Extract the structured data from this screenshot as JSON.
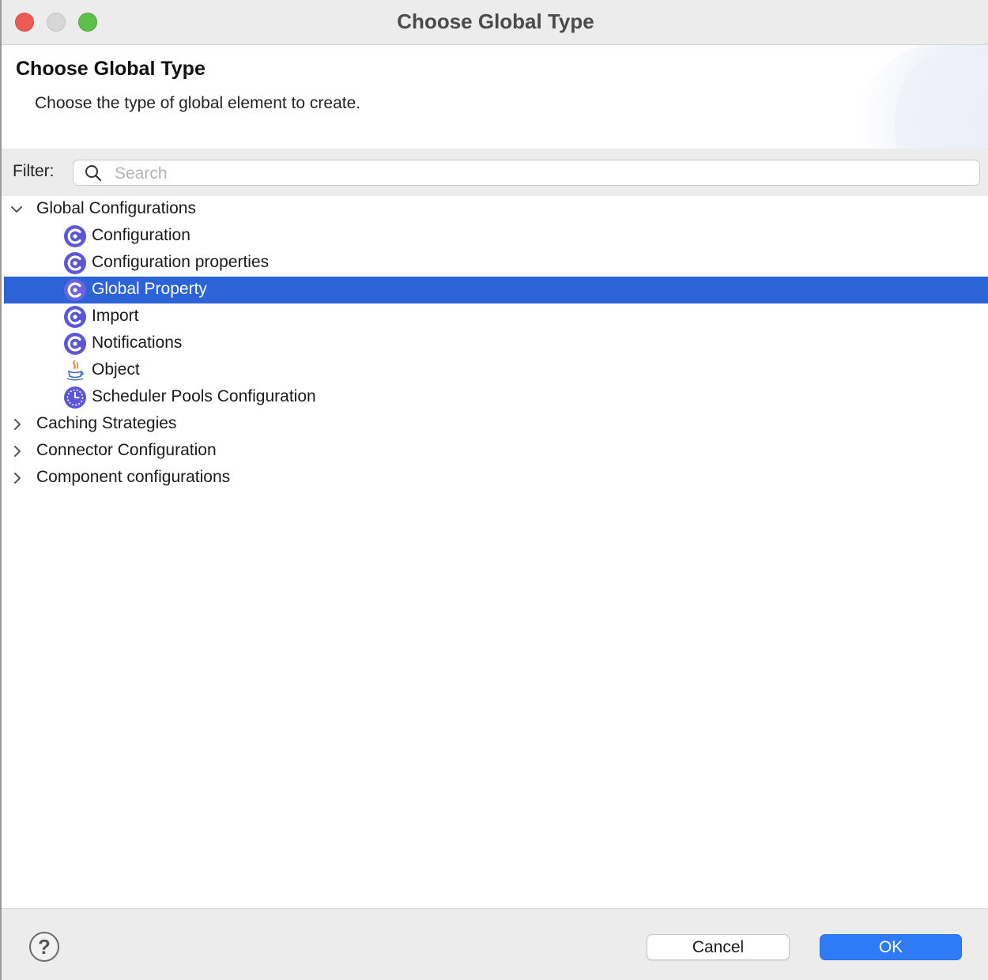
{
  "window": {
    "title": "Choose Global Type"
  },
  "header": {
    "title": "Choose Global Type",
    "subtitle": "Choose the type of global element to create."
  },
  "filter": {
    "label": "Filter:",
    "placeholder": "Search",
    "value": ""
  },
  "tree": {
    "selected": "Global Property",
    "groups": [
      {
        "label": "Global Configurations",
        "expanded": true,
        "children": [
          {
            "label": "Configuration",
            "icon": "config-c-icon"
          },
          {
            "label": "Configuration properties",
            "icon": "config-c-icon"
          },
          {
            "label": "Global Property",
            "icon": "config-c-icon"
          },
          {
            "label": "Import",
            "icon": "config-c-icon"
          },
          {
            "label": "Notifications",
            "icon": "config-c-icon"
          },
          {
            "label": "Object",
            "icon": "java-cup-icon"
          },
          {
            "label": "Scheduler Pools Configuration",
            "icon": "clock-icon"
          }
        ]
      },
      {
        "label": "Caching Strategies",
        "expanded": false
      },
      {
        "label": "Connector Configuration",
        "expanded": false
      },
      {
        "label": "Component configurations",
        "expanded": false
      }
    ]
  },
  "footer": {
    "help_label": "?",
    "cancel_label": "Cancel",
    "ok_label": "OK"
  },
  "colors": {
    "selection": "#2c63d6",
    "ok_button": "#2f7bf5",
    "icon_purple": "#5b57d6"
  }
}
